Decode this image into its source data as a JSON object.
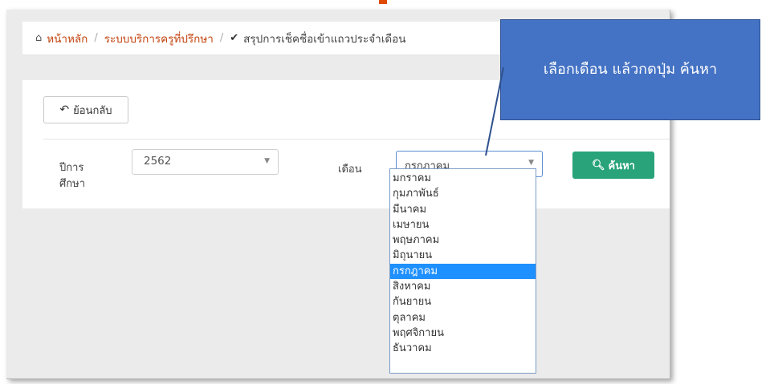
{
  "breadcrumb": {
    "home_label": "หน้าหลัก",
    "section_label": "ระบบบริการครูที่ปรึกษา",
    "separator": "/",
    "current_label": "สรุปการเช็คชื่อเข้าแถวประจำเดือน"
  },
  "toolbar": {
    "back_label": "ย้อนกลับ"
  },
  "form": {
    "year_label": "ปีการศึกษา",
    "year_value": "2562",
    "month_label": "เดือน",
    "month_value": "กรกฎาคม",
    "search_label": "ค้นหา"
  },
  "dropdown": {
    "options": [
      "มกราคม",
      "กุมภาพันธ์",
      "มีนาคม",
      "เมษายน",
      "พฤษภาคม",
      "มิถุนายน",
      "กรกฎาคม",
      "สิงหาคม",
      "กันยายน",
      "ตุลาคม",
      "พฤศจิกายน",
      "ธันวาคม"
    ],
    "selected": "กรกฎาคม"
  },
  "callout": {
    "text": "เลือกเดือน แล้วกดปุ่ม ค้นหา"
  },
  "icons": {
    "home": "home-icon",
    "check": "check-icon",
    "back": "undo-icon",
    "search": "search-icon",
    "caret": "chevron-down-icon"
  },
  "colors": {
    "link": "#c2410c",
    "search_button": "#28a37a",
    "selected_option": "#1e90ff",
    "callout": "#4472c4"
  }
}
